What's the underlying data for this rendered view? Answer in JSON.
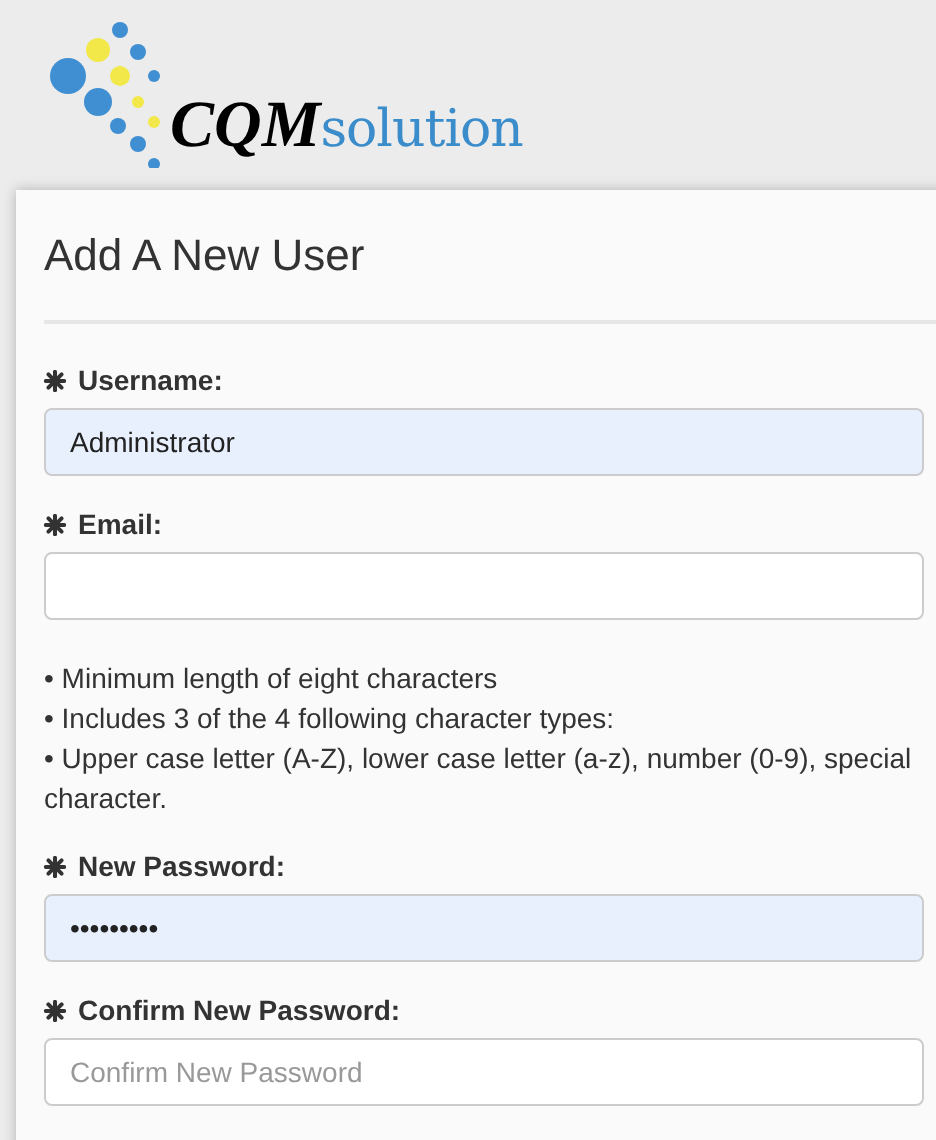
{
  "logo": {
    "brand": "CQM",
    "suffix": "solution"
  },
  "title": "Add A New User",
  "fields": [
    {
      "label": "Username:",
      "required": true,
      "value": "Administrator",
      "autofilled": true
    },
    {
      "label": "Email:",
      "required": true,
      "autofilled": false
    },
    {
      "kind": "rules",
      "lines": [
        "• Minimum length of eight characters",
        "• Includes 3 of the 4 following character types:",
        "• Upper case letter (A-Z), lower case letter (a-z), number (0-9), special character."
      ]
    },
    {
      "label": "New Password:",
      "required": true,
      "value": "•••••••••",
      "autofilled": true
    },
    {
      "label": "Confirm New Password:",
      "required": true,
      "placeholder": "Confirm New Password",
      "autofilled": false
    }
  ]
}
